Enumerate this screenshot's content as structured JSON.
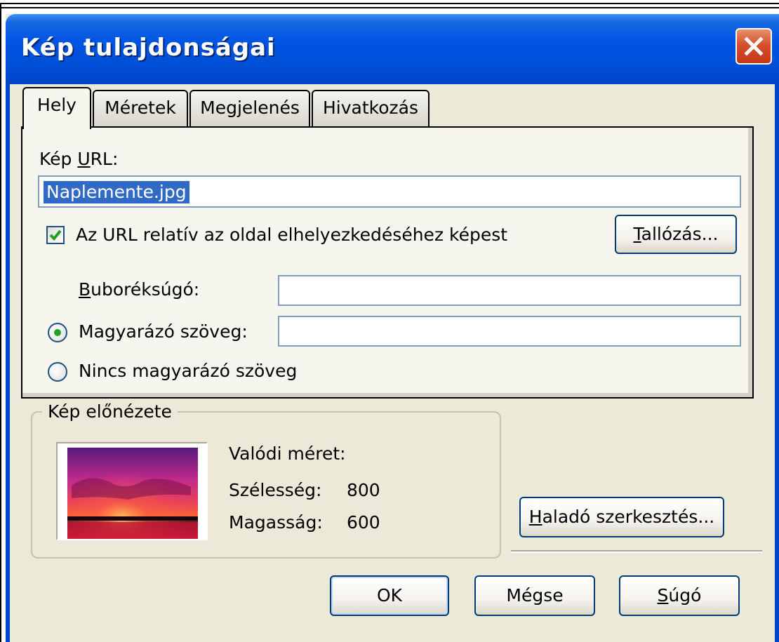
{
  "window": {
    "title": "Kép tulajdonságai",
    "close_icon": "close-icon"
  },
  "tabs": [
    {
      "label": "Hely",
      "active": true
    },
    {
      "label": "Méretek",
      "active": false
    },
    {
      "label": "Megjelenés",
      "active": false
    },
    {
      "label": "Hivatkozás",
      "active": false
    }
  ],
  "location": {
    "url_label_prefix": "Kép ",
    "url_label_accel": "U",
    "url_label_suffix": "RL:",
    "url_value": "Naplemente.jpg",
    "relative_checkbox_label": "Az URL relatív az oldal elhelyezkedéséhez képest",
    "relative_checked": true,
    "browse_accel": "T",
    "browse_suffix": "allózás...",
    "tooltip_accel": "B",
    "tooltip_suffix": "uboréksúgó:",
    "tooltip_value": "",
    "alt_text_label": "Magyarázó szöveg:",
    "alt_text_selected": true,
    "alt_text_value": "",
    "no_alt_text_label": "Nincs magyarázó szöveg"
  },
  "preview": {
    "group_title": "Kép előnézete",
    "real_size_label": "Valódi méret:",
    "width_label": "Szélesség:",
    "width_value": "800",
    "height_label": "Magasság:",
    "height_value": "600"
  },
  "buttons": {
    "advanced_accel": "H",
    "advanced_suffix": "aladó szerkesztés...",
    "ok": "OK",
    "cancel": "Mégse",
    "help_accel": "S",
    "help_suffix": "úgó"
  },
  "colors": {
    "titlebar": "#0054e3",
    "dialog_bg": "#ece9d8",
    "selection": "#316ac5",
    "check": "#21a121"
  }
}
